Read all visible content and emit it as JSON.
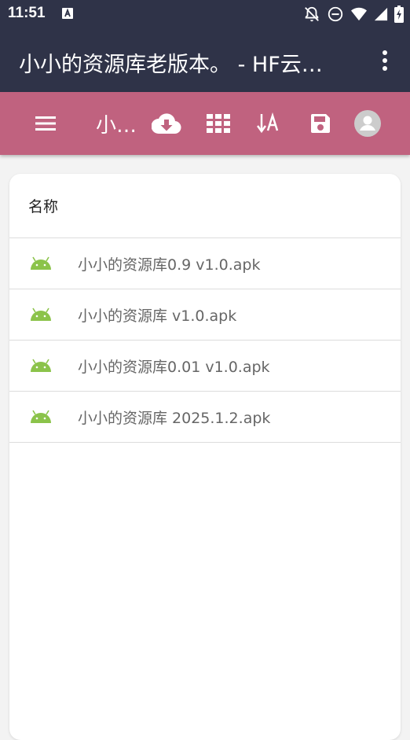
{
  "status": {
    "time": "11:51",
    "icons": [
      "accessibility-a-icon",
      "notifications-off-icon",
      "do-not-disturb-icon",
      "wifi-icon",
      "cell-signal-icon",
      "battery-charging-icon"
    ]
  },
  "appbar": {
    "title": "小小的资源库老版本。 - HF云…",
    "menu_icon": "more-vert-icon"
  },
  "toolbar": {
    "menu_icon": "menu-icon",
    "folder_label": "小…",
    "icons": [
      "cloud-download-icon",
      "grid-view-icon",
      "sort-by-name-icon",
      "save-icon",
      "account-icon"
    ],
    "color": "#c0627f"
  },
  "list": {
    "header": "名称",
    "files": [
      {
        "name": "小小的资源库0.9 v1.0.apk",
        "icon": "android-icon"
      },
      {
        "name": "小小的资源库 v1.0.apk",
        "icon": "android-icon"
      },
      {
        "name": "小小的资源库0.01 v1.0.apk",
        "icon": "android-icon"
      },
      {
        "name": "小小的资源库 2025.1.2.apk",
        "icon": "android-icon"
      }
    ]
  },
  "colors": {
    "appbar": "#2f3348",
    "android": "#8bc34a"
  }
}
